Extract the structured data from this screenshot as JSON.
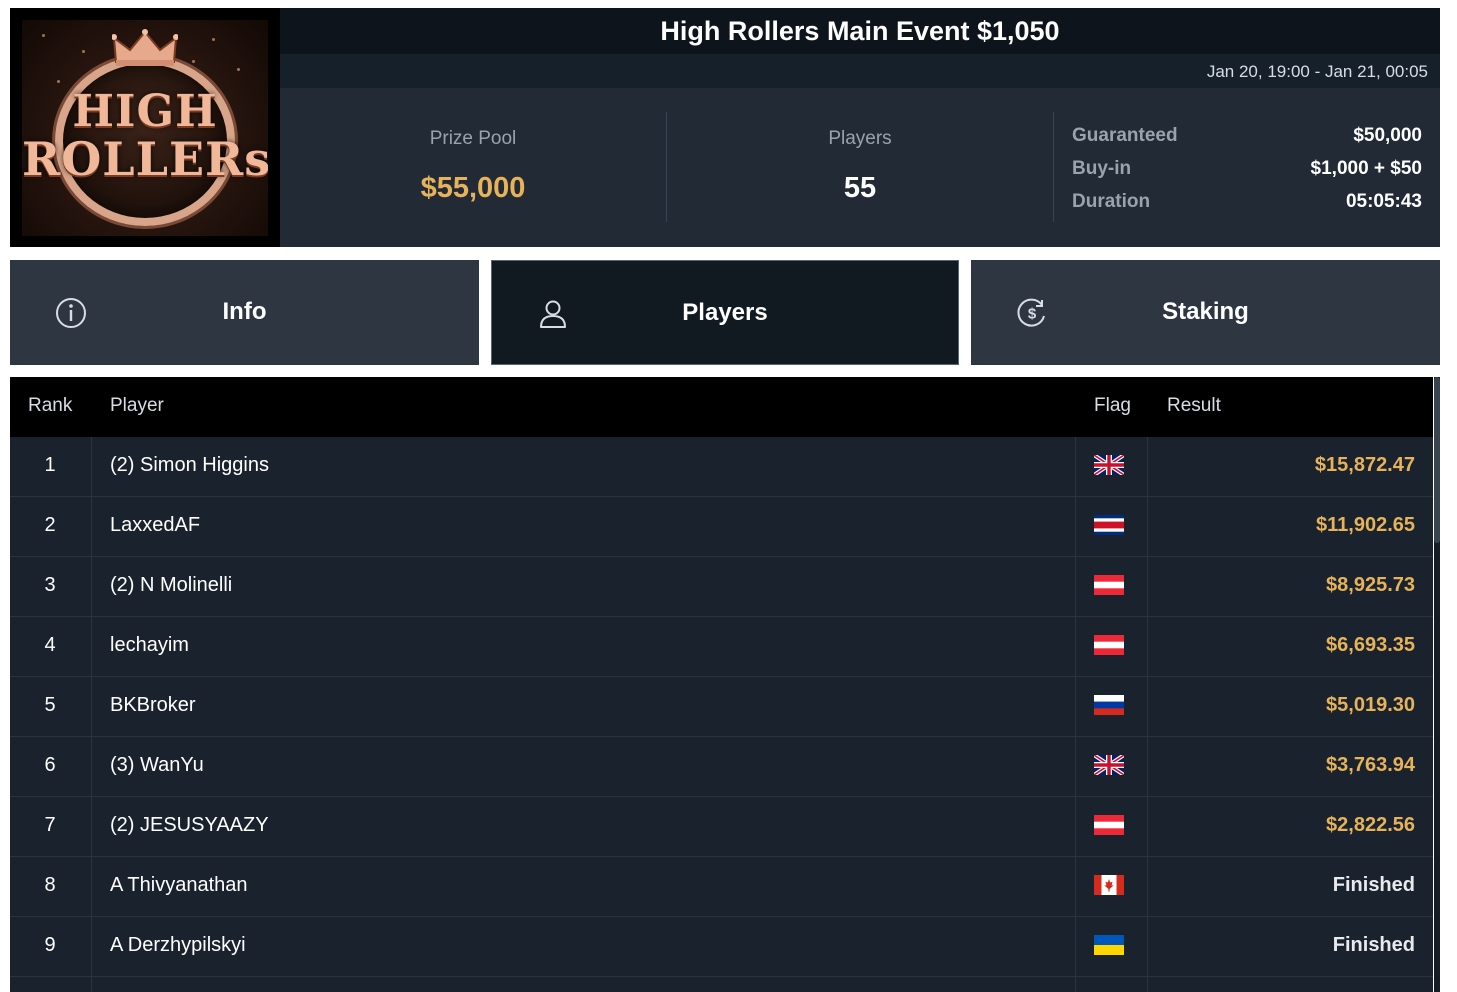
{
  "logo": {
    "line1": "HIGH",
    "line2": "ROLLERs"
  },
  "header": {
    "title": "High Rollers Main Event $1,050",
    "date_range": "Jan 20, 19:00 - Jan 21, 00:05"
  },
  "stats": {
    "prize_pool_label": "Prize Pool",
    "prize_pool_value": "$55,000",
    "players_label": "Players",
    "players_value": "55",
    "guaranteed_label": "Guaranteed",
    "guaranteed_value": "$50,000",
    "buyin_label": "Buy-in",
    "buyin_value": "$1,000 + $50",
    "duration_label": "Duration",
    "duration_value": "05:05:43"
  },
  "tabs": [
    {
      "label": "Info",
      "icon": "info-circle-icon"
    },
    {
      "label": "Players",
      "icon": "user-icon"
    },
    {
      "label": "Staking",
      "icon": "dollar-circle-icon"
    }
  ],
  "table": {
    "headers": {
      "rank": "Rank",
      "player": "Player",
      "flag": "Flag",
      "result": "Result"
    },
    "rows": [
      {
        "rank": "1",
        "player": "(2) Simon Higgins",
        "flag": "gb",
        "result": "$15,872.47",
        "paid": true
      },
      {
        "rank": "2",
        "player": "LaxxedAF",
        "flag": "cr",
        "result": "$11,902.65",
        "paid": true
      },
      {
        "rank": "3",
        "player": "(2) N Molinelli",
        "flag": "at",
        "result": "$8,925.73",
        "paid": true
      },
      {
        "rank": "4",
        "player": "lechayim",
        "flag": "at",
        "result": "$6,693.35",
        "paid": true
      },
      {
        "rank": "5",
        "player": "BKBroker",
        "flag": "ru",
        "result": "$5,019.30",
        "paid": true
      },
      {
        "rank": "6",
        "player": "(3) WanYu",
        "flag": "gb",
        "result": "$3,763.94",
        "paid": true
      },
      {
        "rank": "7",
        "player": "(2) JESUSYAAZY",
        "flag": "at",
        "result": "$2,822.56",
        "paid": true
      },
      {
        "rank": "8",
        "player": "A Thivyanathan",
        "flag": "ca",
        "result": "Finished",
        "paid": false
      },
      {
        "rank": "9",
        "player": "A Derzhypilskyi",
        "flag": "ua",
        "result": "Finished",
        "paid": false
      }
    ]
  },
  "colors": {
    "accent_gold": "#e6b25a",
    "background_dark": "#1a232d",
    "header_black": "#000000"
  }
}
